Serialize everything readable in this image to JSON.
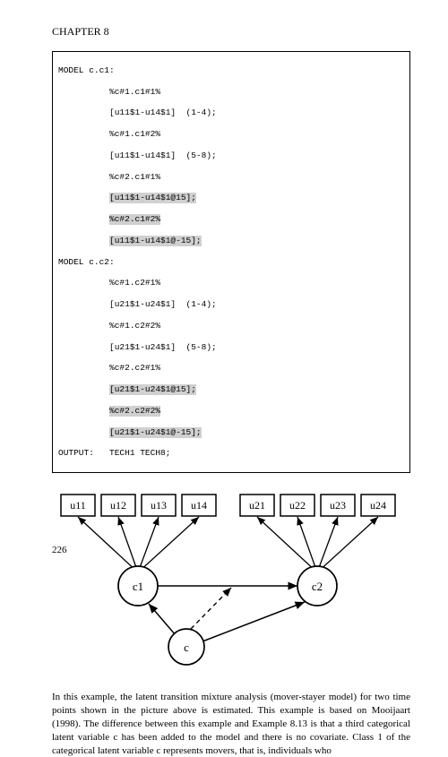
{
  "chapter": "CHAPTER 8",
  "code": {
    "l1": "MODEL c.c1:",
    "l2": "          %c#1.c1#1%",
    "l3": "          [u11$1-u14$1]  (1-4);",
    "l4": "          %c#1.c1#2%",
    "l5": "          [u11$1-u14$1]  (5-8);",
    "l6": "          %c#2.c1#1%",
    "l7a": "          ",
    "l7b": "[u11$1-u14$1@15];",
    "l8a": "          ",
    "l8b": "%c#2.c1#2%",
    "l9a": "          ",
    "l9b": "[u11$1-u14$1@-15];",
    "l10": "MODEL c.c2:",
    "l11": "          %c#1.c2#1%",
    "l12": "          [u21$1-u24$1]  (1-4);",
    "l13": "          %c#1.c2#2%",
    "l14": "          [u21$1-u24$1]  (5-8);",
    "l15": "          %c#2.c2#1%",
    "l16a": "          ",
    "l16b": "[u21$1-u24$1@15];",
    "l17a": "          ",
    "l17b": "%c#2.c2#2%",
    "l18a": "          ",
    "l18b": "[u21$1-u24$1@-15];",
    "l19": "OUTPUT:   TECH1 TECH8;"
  },
  "diagram": {
    "boxes": [
      "u11",
      "u12",
      "u13",
      "u14",
      "u21",
      "u22",
      "u23",
      "u24"
    ],
    "circles": [
      "c1",
      "c2",
      "c"
    ]
  },
  "body": "In this example, the latent transition mixture analysis (mover-stayer model) for two time points shown in the picture above is estimated.  This example is based on Mooijaart (1998).  The difference between this example and Example 8.13 is that a third categorical latent variable c has been added to the model and there is no covariate.  Class 1 of the categorical latent variable c represents movers, that is, individuals who",
  "pageNumber": "226"
}
